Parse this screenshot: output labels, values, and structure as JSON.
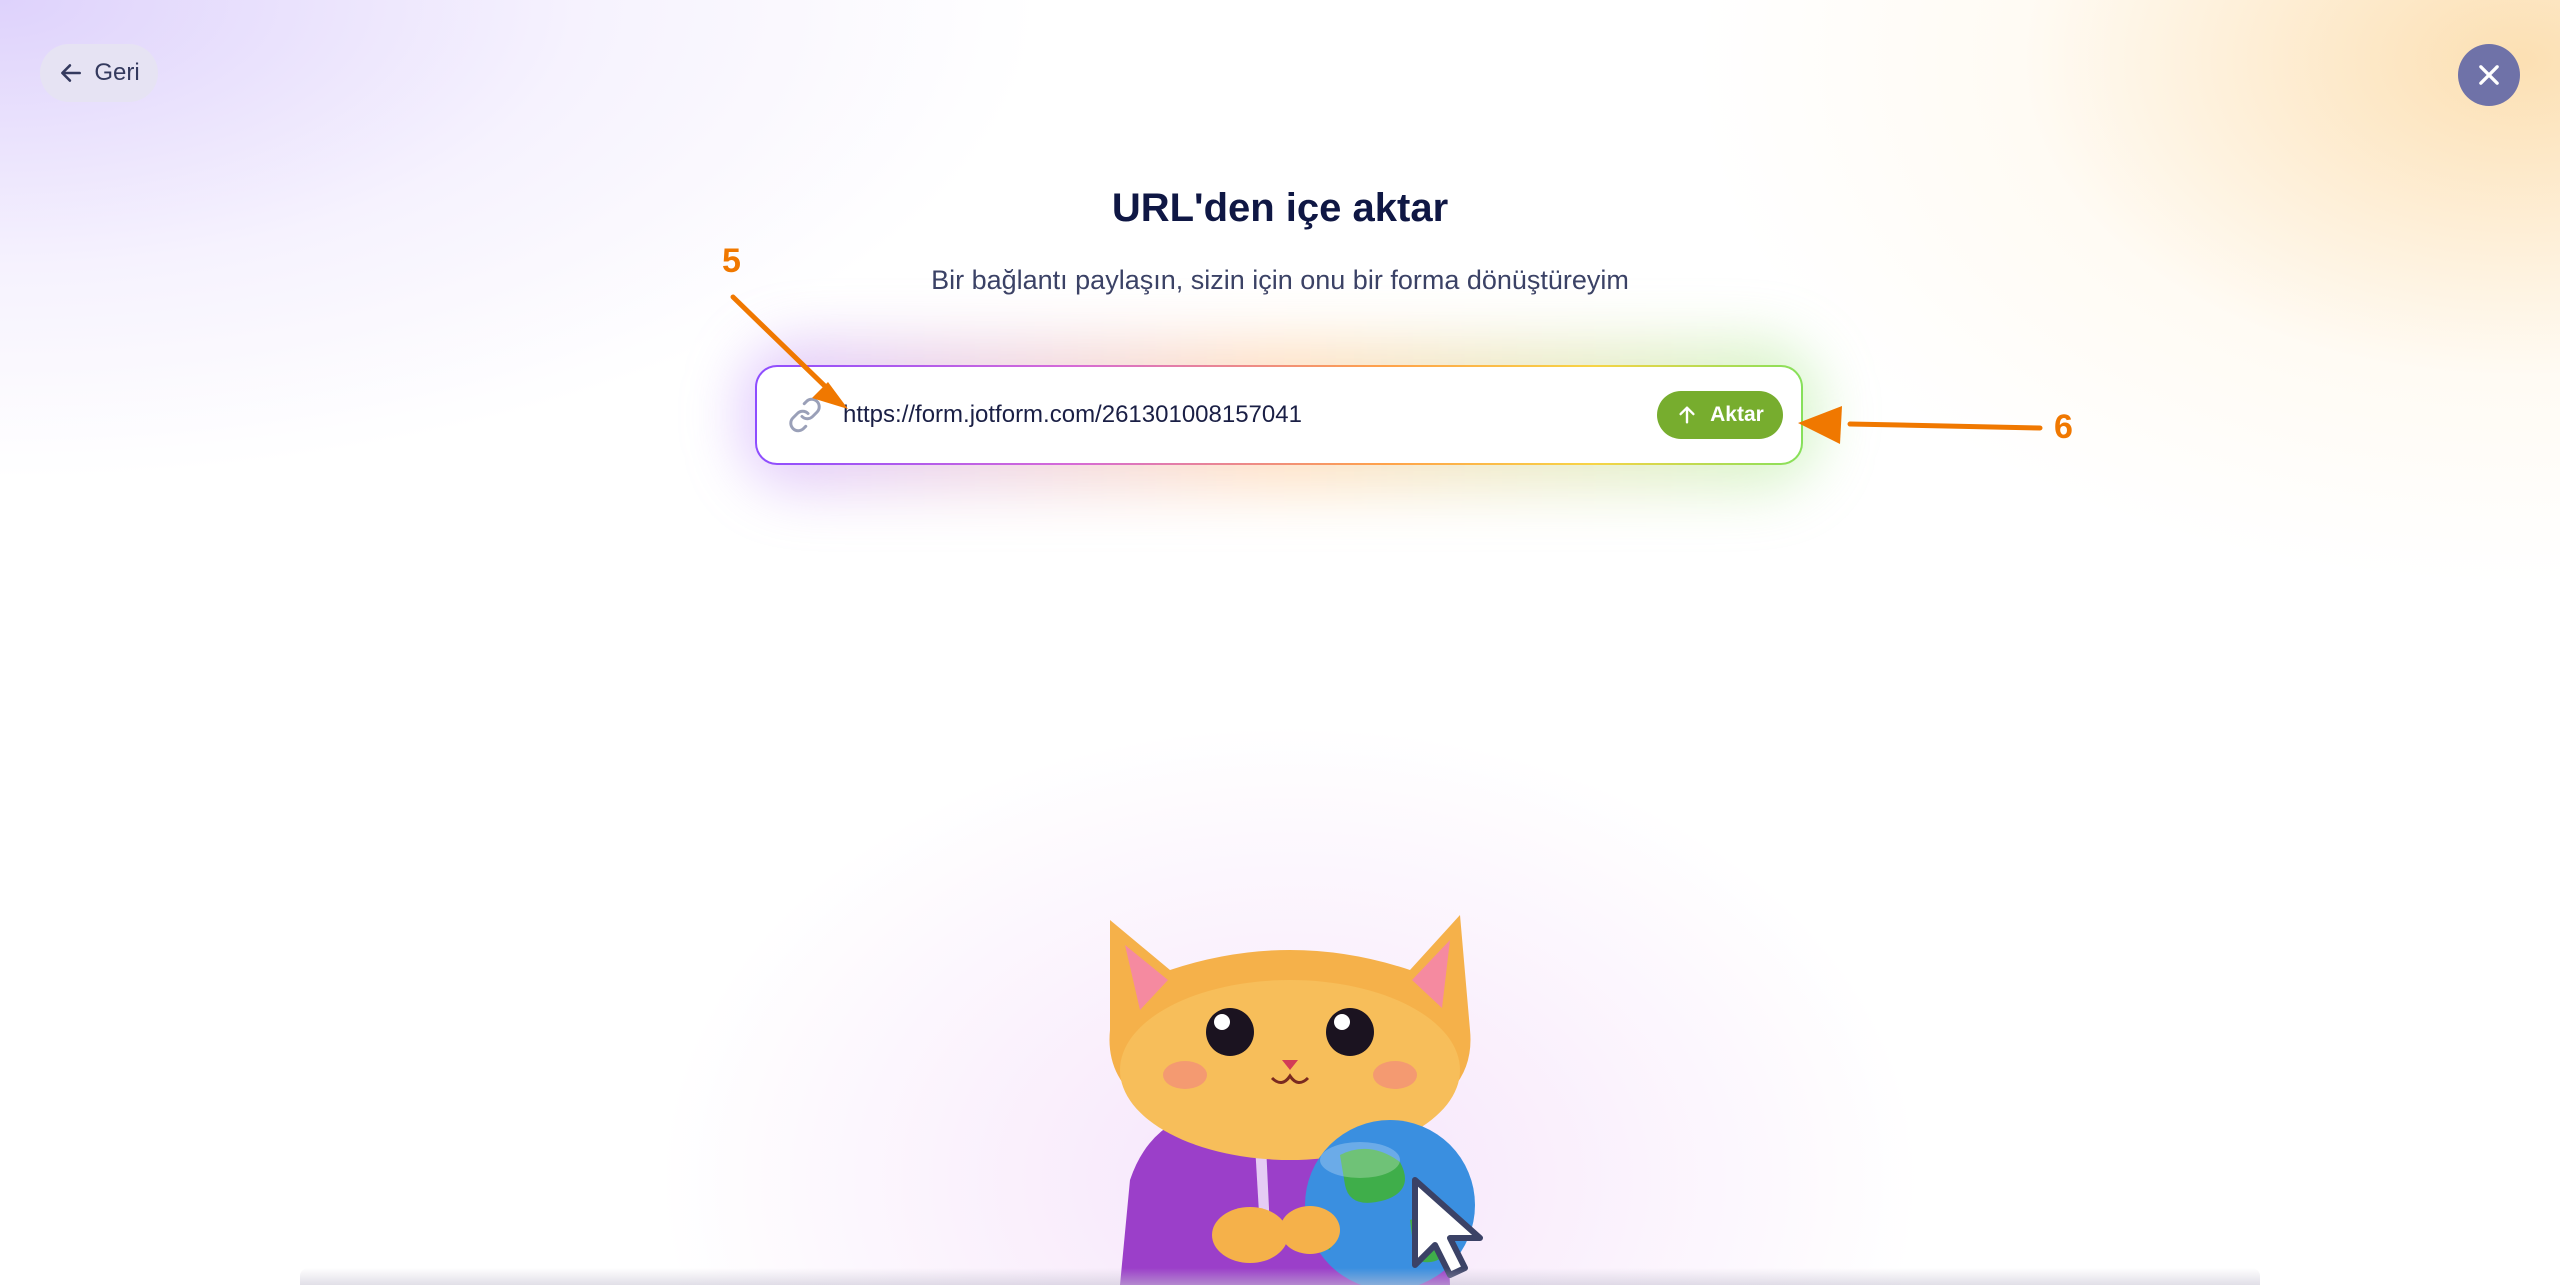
{
  "nav": {
    "back_label": "Geri",
    "back_icon": "arrow-left-icon",
    "close_icon": "close-icon"
  },
  "header": {
    "title": "URL'den içe aktar",
    "subtitle": "Bir bağlantı paylaşın, sizin için onu bir forma dönüştüreyim"
  },
  "url_form": {
    "link_icon": "link-icon",
    "value": "https://form.jotform.com/261301008157041",
    "button_label": "Aktar",
    "button_icon": "arrow-up-icon"
  },
  "annotations": {
    "marker_5": "5",
    "marker_6": "6",
    "color": "#f07800"
  },
  "mascot": {
    "description_icon": "cat-mascot-with-globe-icon"
  },
  "colors": {
    "title": "#0f1744",
    "button": "#77ad2e",
    "close_button": "#6f72a8",
    "back_button": "#e6e3f3"
  }
}
